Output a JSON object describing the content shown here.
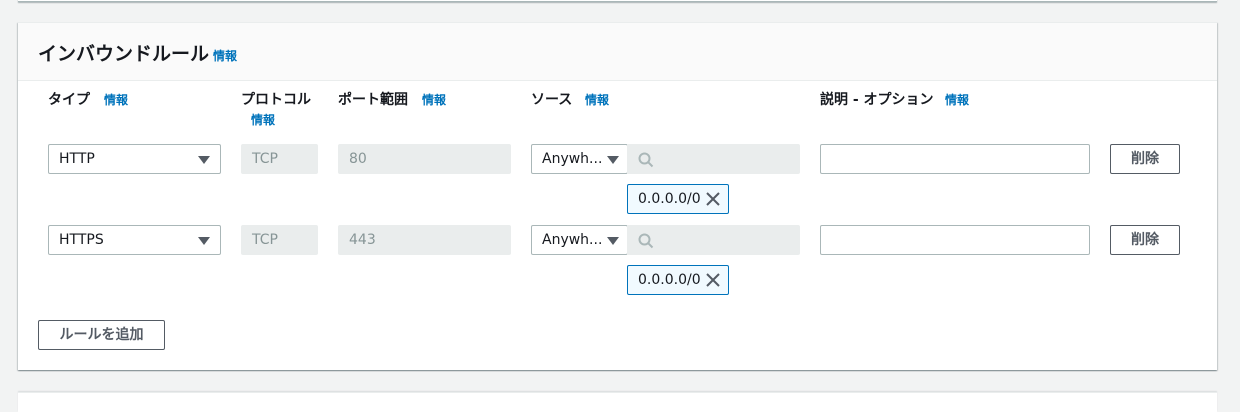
{
  "panel": {
    "title": "インバウンドルール",
    "info_label": "情報"
  },
  "columns": {
    "type": "タイプ",
    "protocol": "プロトコル",
    "port_range": "ポート範囲",
    "source": "ソース",
    "description": "説明 - オプション",
    "info_label": "情報"
  },
  "rules": [
    {
      "type": "HTTP",
      "protocol": "TCP",
      "port_range": "80",
      "source_select": "Anywh...",
      "source_search_placeholder": "",
      "source_token": "0.0.0.0/0",
      "description": "",
      "delete_label": "削除"
    },
    {
      "type": "HTTPS",
      "protocol": "TCP",
      "port_range": "443",
      "source_select": "Anywh...",
      "source_search_placeholder": "",
      "source_token": "0.0.0.0/0",
      "description": "",
      "delete_label": "削除"
    }
  ],
  "add_rule_label": "ルールを追加",
  "colors": {
    "info_link": "#0073bb",
    "token_border": "#0073bb",
    "disabled_bg": "#eaeded"
  }
}
